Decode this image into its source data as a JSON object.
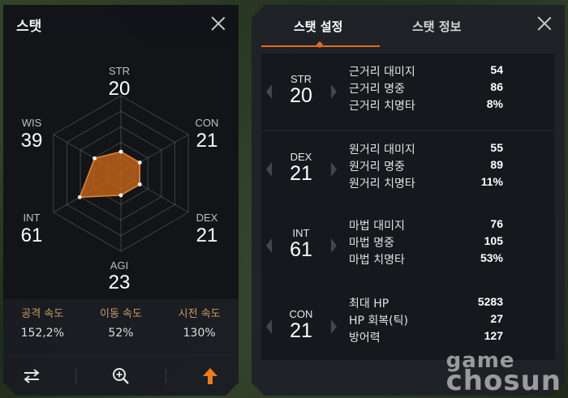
{
  "stat_panel": {
    "title": "스탯",
    "radar": {
      "axes": [
        {
          "label": "STR",
          "value": "20"
        },
        {
          "label": "CON",
          "value": "21"
        },
        {
          "label": "DEX",
          "value": "21"
        },
        {
          "label": "AGI",
          "value": "23"
        },
        {
          "label": "INT",
          "value": "61"
        },
        {
          "label": "WIS",
          "value": "39"
        }
      ],
      "fill_color": "#c8641a",
      "stroke_color": "#e0893a"
    },
    "speeds": [
      {
        "label": "공격 속도",
        "value": "152,2%"
      },
      {
        "label": "이동 속도",
        "value": "52%"
      },
      {
        "label": "시전 속도",
        "value": "130%"
      }
    ],
    "toolbar": {
      "swap_icon": "swap-arrows-icon",
      "zoom_icon": "zoom-in-icon",
      "upgrade_icon": "level-up-arrow-icon"
    }
  },
  "details_panel": {
    "tabs": [
      {
        "label": "스탯 설정",
        "active": true
      },
      {
        "label": "스탯 정보",
        "active": false
      }
    ],
    "accent_color": "#e36a1c",
    "cards": [
      {
        "stat": "STR",
        "value": "20",
        "rows": [
          {
            "label": "근거리 대미지",
            "value": "54"
          },
          {
            "label": "근거리 명중",
            "value": "86"
          },
          {
            "label": "근거리 치명타",
            "value": "8%"
          }
        ]
      },
      {
        "stat": "DEX",
        "value": "21",
        "rows": [
          {
            "label": "원거리 대미지",
            "value": "55"
          },
          {
            "label": "원거리 명중",
            "value": "89"
          },
          {
            "label": "원거리 치명타",
            "value": "11%"
          }
        ]
      },
      {
        "stat": "INT",
        "value": "61",
        "rows": [
          {
            "label": "마법 대미지",
            "value": "76"
          },
          {
            "label": "마법 명중",
            "value": "105"
          },
          {
            "label": "마법 치명타",
            "value": "53%"
          }
        ]
      },
      {
        "stat": "CON",
        "value": "21",
        "rows": [
          {
            "label": "최대 HP",
            "value": "5283"
          },
          {
            "label": "HP 회복(틱)",
            "value": "27"
          },
          {
            "label": "방어력",
            "value": "127"
          }
        ]
      }
    ]
  },
  "watermark": {
    "line1": "game",
    "line2": "chosun"
  }
}
